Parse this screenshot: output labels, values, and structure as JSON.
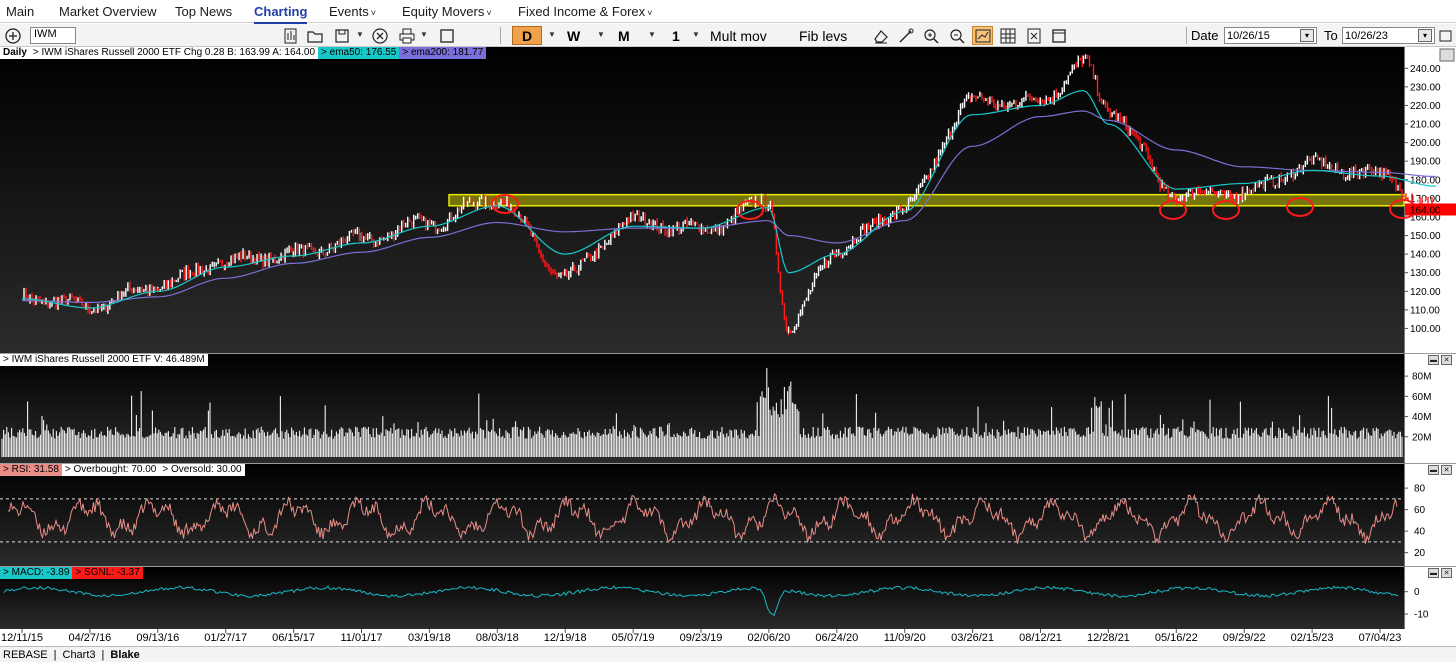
{
  "nav": {
    "items": [
      {
        "label": "Main",
        "dropdown": false,
        "active": false
      },
      {
        "label": "Market Overview",
        "dropdown": false,
        "active": false
      },
      {
        "label": "Top News",
        "dropdown": false,
        "active": false
      },
      {
        "label": "Charting",
        "dropdown": false,
        "active": true
      },
      {
        "label": "Events",
        "dropdown": true,
        "active": false
      },
      {
        "label": "Equity Movers",
        "dropdown": true,
        "active": false
      },
      {
        "label": "Fixed Income & Forex",
        "dropdown": true,
        "active": false
      }
    ]
  },
  "toolbar": {
    "symbol": "IWM",
    "timeframes": [
      "D",
      "W",
      "M",
      "1"
    ],
    "mult_mov": "Mult mov",
    "fib_levs": "Fib levs",
    "date_label": "Date",
    "date_from": "10/26/15",
    "to_label": "To",
    "date_to": "10/26/23"
  },
  "price_pane": {
    "period": "Daily",
    "title": "IWM  iShares Russell 2000 ETF  Chg 0.28  B: 163.99  A: 164.00",
    "ema50": "ema50: 176.55",
    "ema200": "ema200: 181.77",
    "last_price": "164.00",
    "y_ticks": [
      "240.00",
      "230.00",
      "220.00",
      "210.00",
      "200.00",
      "190.00",
      "180.00",
      "170.00",
      "160.00",
      "150.00",
      "140.00",
      "130.00",
      "120.00",
      "110.00",
      "100.00"
    ]
  },
  "volume_pane": {
    "title": "IWM  iShares Russell 2000 ETF  V: 46.489M",
    "y_ticks": [
      "80M",
      "60M",
      "40M",
      "20M"
    ]
  },
  "rsi_pane": {
    "rsi": "RSI: 31.58",
    "overbought": "Overbought: 70.00",
    "oversold": "Oversold: 30.00",
    "y_ticks": [
      "80",
      "60",
      "40",
      "20"
    ]
  },
  "macd_pane": {
    "macd": "MACD: -3.89",
    "sgnl": "SGNL: -3.37",
    "y_ticks": [
      "0",
      "-10"
    ]
  },
  "x_axis": [
    "12/11/15",
    "04/27/16",
    "09/13/16",
    "01/27/17",
    "06/15/17",
    "11/01/17",
    "03/19/18",
    "08/03/18",
    "12/19/18",
    "05/07/19",
    "09/23/19",
    "02/06/20",
    "06/24/20",
    "11/09/20",
    "03/26/21",
    "08/12/21",
    "12/28/21",
    "05/16/22",
    "09/29/22",
    "02/15/23",
    "07/04/23"
  ],
  "footer": {
    "items": [
      "REBASE",
      "Chart3",
      "Blake"
    ]
  },
  "colors": {
    "chart_bg": "#000000",
    "ema50": "#19c7c7",
    "ema200": "#7a6fd8",
    "support_band": "#e8e800",
    "rsi": "#e98d87",
    "macd": "#19b7c7",
    "down_candle": "#ff1a1a",
    "last_price_tag": "#ff0000"
  },
  "chart_data": {
    "type": "line",
    "series": [
      {
        "name": "IWM",
        "x": [
          "12/11/15",
          "04/27/16",
          "09/13/16",
          "01/27/17",
          "06/15/17",
          "11/01/17",
          "03/19/18",
          "08/03/18",
          "12/19/18",
          "05/07/19",
          "09/23/19",
          "02/06/20",
          "03/18/20",
          "06/24/20",
          "11/09/20",
          "03/26/21",
          "08/12/21",
          "11/08/21",
          "12/28/21",
          "05/16/22",
          "09/29/22",
          "02/15/23",
          "07/04/23",
          "10/26/23"
        ],
        "y": [
          117,
          112,
          123,
          136,
          140,
          148,
          157,
          170,
          128,
          158,
          153,
          168,
          100,
          143,
          165,
          222,
          222,
          243,
          218,
          172,
          173,
          188,
          183,
          164
        ]
      },
      {
        "name": "ema50",
        "x": [
          "12/11/15",
          "04/27/16",
          "09/13/16",
          "01/27/17",
          "06/15/17",
          "11/01/17",
          "03/19/18",
          "08/03/18",
          "12/19/18",
          "05/07/19",
          "09/23/19",
          "02/06/20",
          "03/18/20",
          "06/24/20",
          "11/09/20",
          "03/26/21",
          "08/12/21",
          "11/08/21",
          "12/28/21",
          "05/16/22",
          "09/29/22",
          "02/15/23",
          "07/04/23",
          "10/26/23"
        ],
        "y": [
          116,
          111,
          120,
          133,
          139,
          146,
          155,
          166,
          140,
          155,
          154,
          165,
          130,
          140,
          163,
          215,
          220,
          228,
          210,
          175,
          178,
          185,
          182,
          176.55
        ]
      },
      {
        "name": "ema200",
        "x": [
          "12/11/15",
          "04/27/16",
          "09/13/16",
          "01/27/17",
          "06/15/17",
          "11/01/17",
          "03/19/18",
          "08/03/18",
          "12/19/18",
          "05/07/19",
          "09/23/19",
          "02/06/20",
          "03/18/20",
          "06/24/20",
          "11/09/20",
          "03/26/21",
          "08/12/21",
          "11/08/21",
          "12/28/21",
          "05/16/22",
          "09/29/22",
          "02/15/23",
          "07/04/23",
          "10/26/23"
        ],
        "y": [
          115,
          114,
          117,
          127,
          135,
          141,
          149,
          157,
          152,
          154,
          154,
          158,
          150,
          146,
          158,
          198,
          214,
          217,
          212,
          196,
          187,
          185,
          184,
          181.77
        ]
      }
    ],
    "support_band": [
      166,
      172
    ],
    "ylim": [
      90,
      245
    ],
    "log_scale": false
  }
}
